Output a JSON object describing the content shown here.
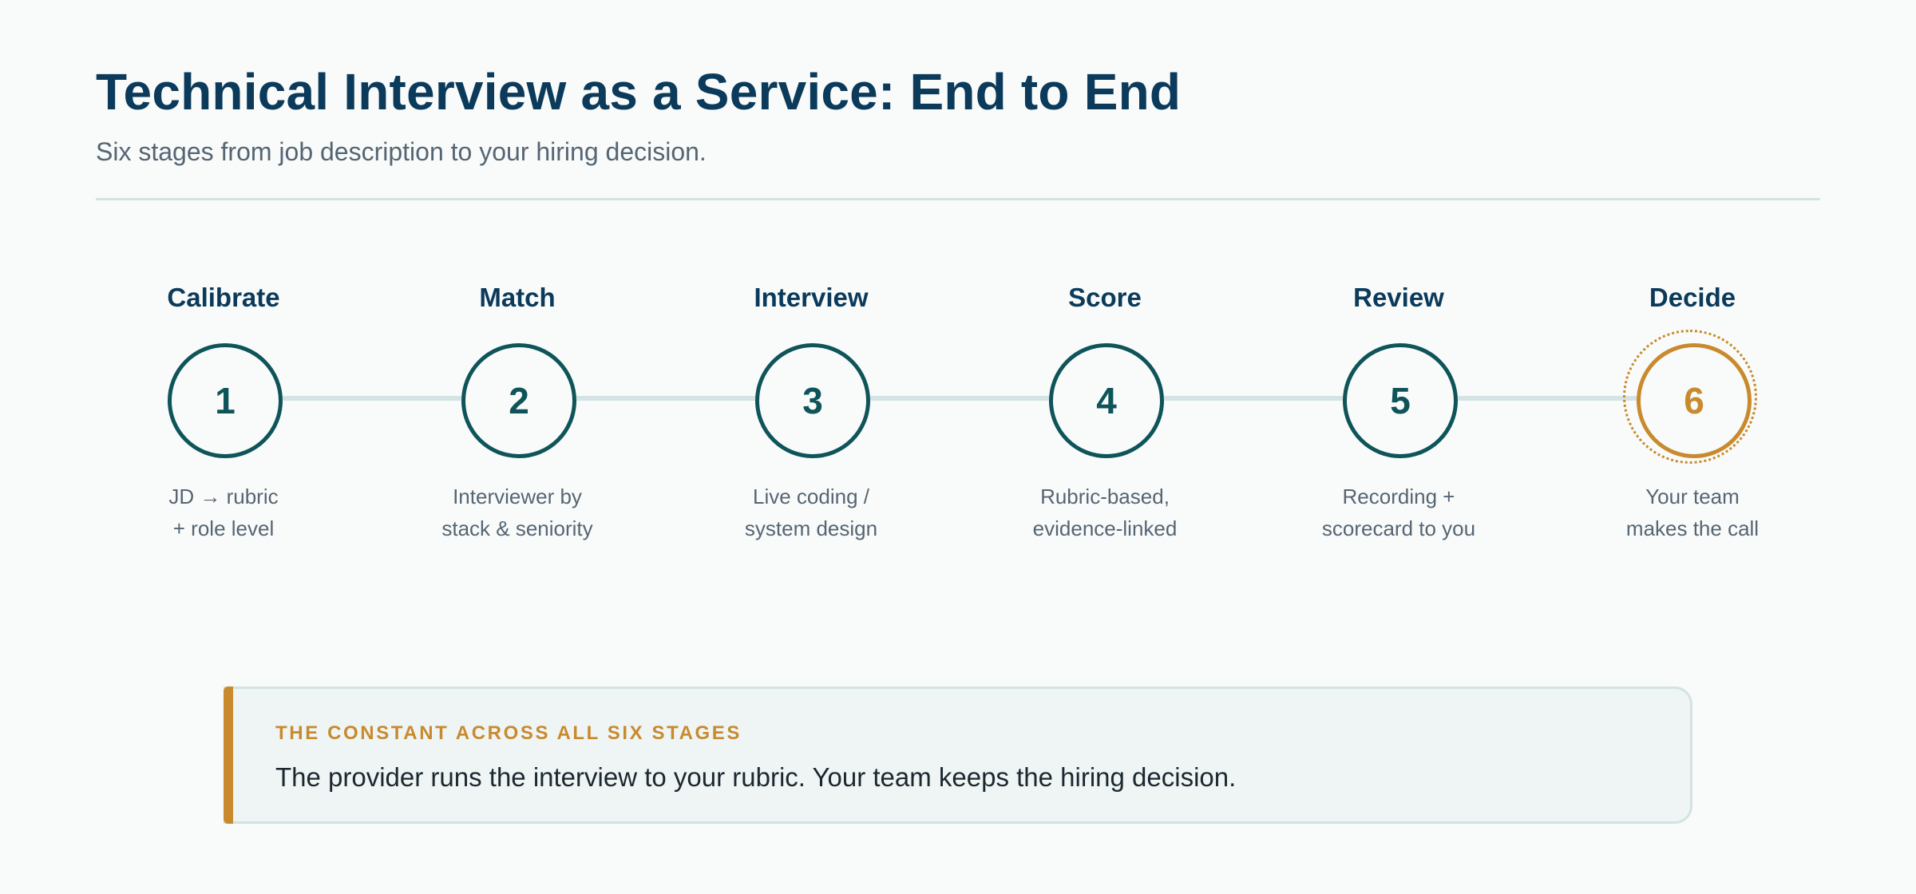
{
  "header": {
    "title": "Technical Interview as a Service: End to End",
    "subtitle": "Six stages from job description to your hiring decision."
  },
  "stages": [
    {
      "name": "Calibrate",
      "number": "1",
      "desc": [
        "JD → rubric",
        "+ role level"
      ]
    },
    {
      "name": "Match",
      "number": "2",
      "desc": [
        "Interviewer by",
        "stack & seniority"
      ]
    },
    {
      "name": "Interview",
      "number": "3",
      "desc": [
        "Live coding /",
        "system design"
      ]
    },
    {
      "name": "Score",
      "number": "4",
      "desc": [
        "Rubric-based,",
        "evidence-linked"
      ]
    },
    {
      "name": "Review",
      "number": "5",
      "desc": [
        "Recording +",
        "scorecard to you"
      ]
    },
    {
      "name": "Decide",
      "number": "6",
      "desc": [
        "Your team",
        "makes the call"
      ]
    }
  ],
  "callout": {
    "eyebrow": "THE CONSTANT ACROSS ALL SIX STAGES",
    "text": "The provider runs the interview to your rubric. Your team keeps the hiring decision."
  },
  "colors": {
    "primary": "#0b3a5b",
    "stage_stroke": "#0e5459",
    "accent": "#c98a2e",
    "muted_text": "#566573",
    "connector": "#d4e4e4"
  }
}
